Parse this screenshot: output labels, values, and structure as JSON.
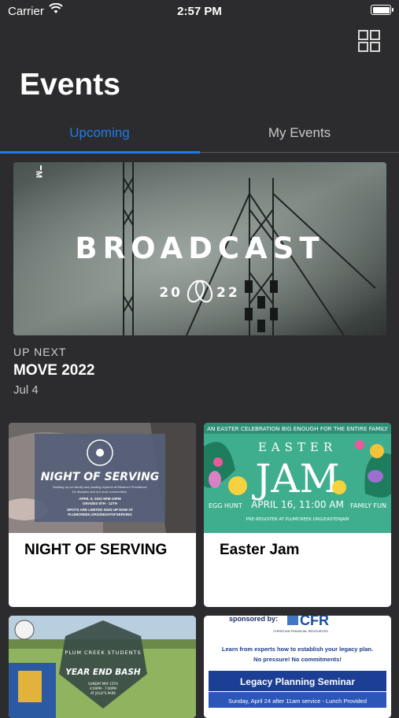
{
  "status_bar": {
    "carrier": "Carrier",
    "time": "2:57 PM"
  },
  "header": {
    "title": "Events",
    "grid_icon": "grid-icon"
  },
  "tabs": [
    {
      "label": "Upcoming",
      "active": true
    },
    {
      "label": "My Events",
      "active": false
    }
  ],
  "hero": {
    "logo": "M",
    "title": "BROADCAST",
    "year_left": "20",
    "year_right": "22"
  },
  "up_next": {
    "label": "UP NEXT",
    "title": "MOVE 2022",
    "date": "Jul 4"
  },
  "cards": [
    {
      "title": "NIGHT OF SERVING",
      "art": {
        "headline": "NIGHT OF SERVING",
        "line1": "Building up our family and planting rhythms at Mission's Providence",
        "line2": "for disciples and our local communities.",
        "line3": "APRIL 9, 2022 6PM-10PM",
        "line4": "GRADES 6TH - 12TH",
        "line5": "SPOTS ARE LIMITED SIGN UP NOW AT",
        "line6": "PLUMCREEK.ORG/NIGHTOFSERVING"
      }
    },
    {
      "title": "Easter Jam",
      "art": {
        "top": "AN EASTER CELEBRATION BIG ENOUGH FOR THE ENTIRE FAMILY",
        "easter": "EASTER",
        "jam": "JAM",
        "date": "APRIL 16, 11:00 AM",
        "left": "EGG HUNT",
        "right": "FAMILY FUN",
        "register": "PRE-REGISTER AT PLUMCREEK.ORG/EASTERJAM"
      }
    },
    {
      "title": "",
      "art": {
        "brand": "PLUM CREEK STUDENTS",
        "headline": "YEAR END BASH",
        "line1": "SUNDAY MAY 15TH",
        "line2": "4:00PM - 7:00PM",
        "line3": "AT JOLLY'S PARK"
      }
    },
    {
      "title": "",
      "art": {
        "sponsored": "sponsored by:",
        "logo": "CFR",
        "logo_sub": "CHRISTIAN FINANCIAL RESOURCES",
        "line1": "Learn from experts how to establish your legacy plan.",
        "line2": "No pressure! No commitments!",
        "banner": "Legacy Planning Seminar",
        "footer": "Sunday, April 24 after 11am service - Lunch Provided"
      }
    }
  ],
  "colors": {
    "background": "#2c2c2e",
    "accent": "#1f7be8",
    "card": "#ffffff"
  }
}
